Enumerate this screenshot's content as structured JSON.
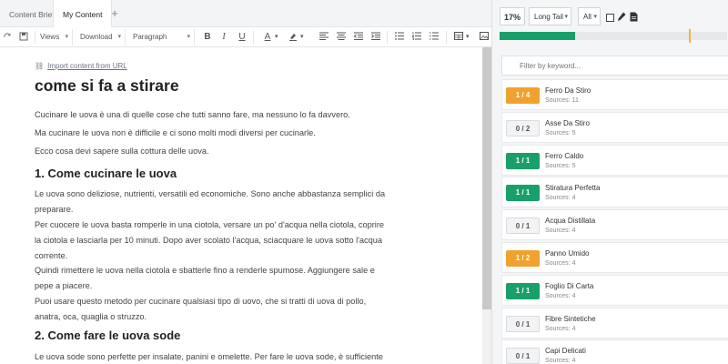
{
  "tabs": [
    {
      "label": "Content Brief",
      "active": false
    },
    {
      "label": "My Content",
      "active": true
    }
  ],
  "tab_add": "+",
  "toolbar": {
    "views_label": "Views",
    "download_label": "Download",
    "paragraph_label": "Paragraph",
    "bold": "B",
    "italic": "I",
    "underline": "U",
    "font_color": "A"
  },
  "content": {
    "import_link": "Import content from URL",
    "title": "come si fa a stirare",
    "paragraphs": [
      "Cucinare le uova è una di quelle cose che tutti sanno fare, ma nessuno lo fa davvero.",
      "Ma cucinare le uova non è difficile e ci sono molti modi diversi per cucinarle.",
      "Ecco cosa devi sapere sulla cottura delle uova.",
      "Le uova sono deliziose, nutrienti, versatili ed economiche. Sono anche abbastanza semplici da preparare.",
      "Per cuocere le uova basta romperle in una ciotola, versare un po' d'acqua nella ciotola, coprire la ciotola e lasciarla per 10 minuti. Dopo aver scolato l'acqua, sciacquare le uova sotto l'acqua corrente.",
      "Quindi rimettere le uova nella ciotola e sbatterle fino a renderle spumose. Aggiungere sale e pepe a piacere.",
      "Puoi usare questo metodo per cucinare qualsiasi tipo di uovo, che si tratti di uova di pollo, anatra, oca, quaglia o struzzo.",
      "Le uova sode sono perfette per insalate, panini e omelette. Per fare le uova sode, è sufficiente"
    ],
    "headings": [
      "1. Come cucinare le uova",
      "2. Come fare le uova sode"
    ]
  },
  "panel": {
    "score": "17%",
    "tail_select": "Long Tail",
    "all_select": "All",
    "progress": {
      "value": 0.33,
      "target": 0.83
    },
    "filter_placeholder": "Filter by keyword...",
    "keywords": [
      {
        "count": "1 / 4",
        "name": "Ferro Da Stiro",
        "sources": "Sources: 11",
        "status": "orange"
      },
      {
        "count": "0 / 2",
        "name": "Asse Da Stiro",
        "sources": "Sources: 5",
        "status": "gray"
      },
      {
        "count": "1 / 1",
        "name": "Ferro Caldo",
        "sources": "Sources: 5",
        "status": "green"
      },
      {
        "count": "1 / 1",
        "name": "Stiratura Perfetta",
        "sources": "Sources: 4",
        "status": "green"
      },
      {
        "count": "0 / 1",
        "name": "Acqua Distillata",
        "sources": "Sources: 4",
        "status": "gray"
      },
      {
        "count": "1 / 2",
        "name": "Panno Umido",
        "sources": "Sources: 4",
        "status": "orange"
      },
      {
        "count": "1 / 1",
        "name": "Foglio Di Carta",
        "sources": "Sources: 4",
        "status": "green"
      },
      {
        "count": "0 / 1",
        "name": "Fibre Sintetiche",
        "sources": "Sources: 4",
        "status": "gray"
      },
      {
        "count": "0 / 1",
        "name": "Capi Delicati",
        "sources": "Sources: 4",
        "status": "gray"
      }
    ]
  },
  "colors": {
    "green": "#18a06a",
    "orange": "#efa32e",
    "gray": "#f2f3f5"
  }
}
